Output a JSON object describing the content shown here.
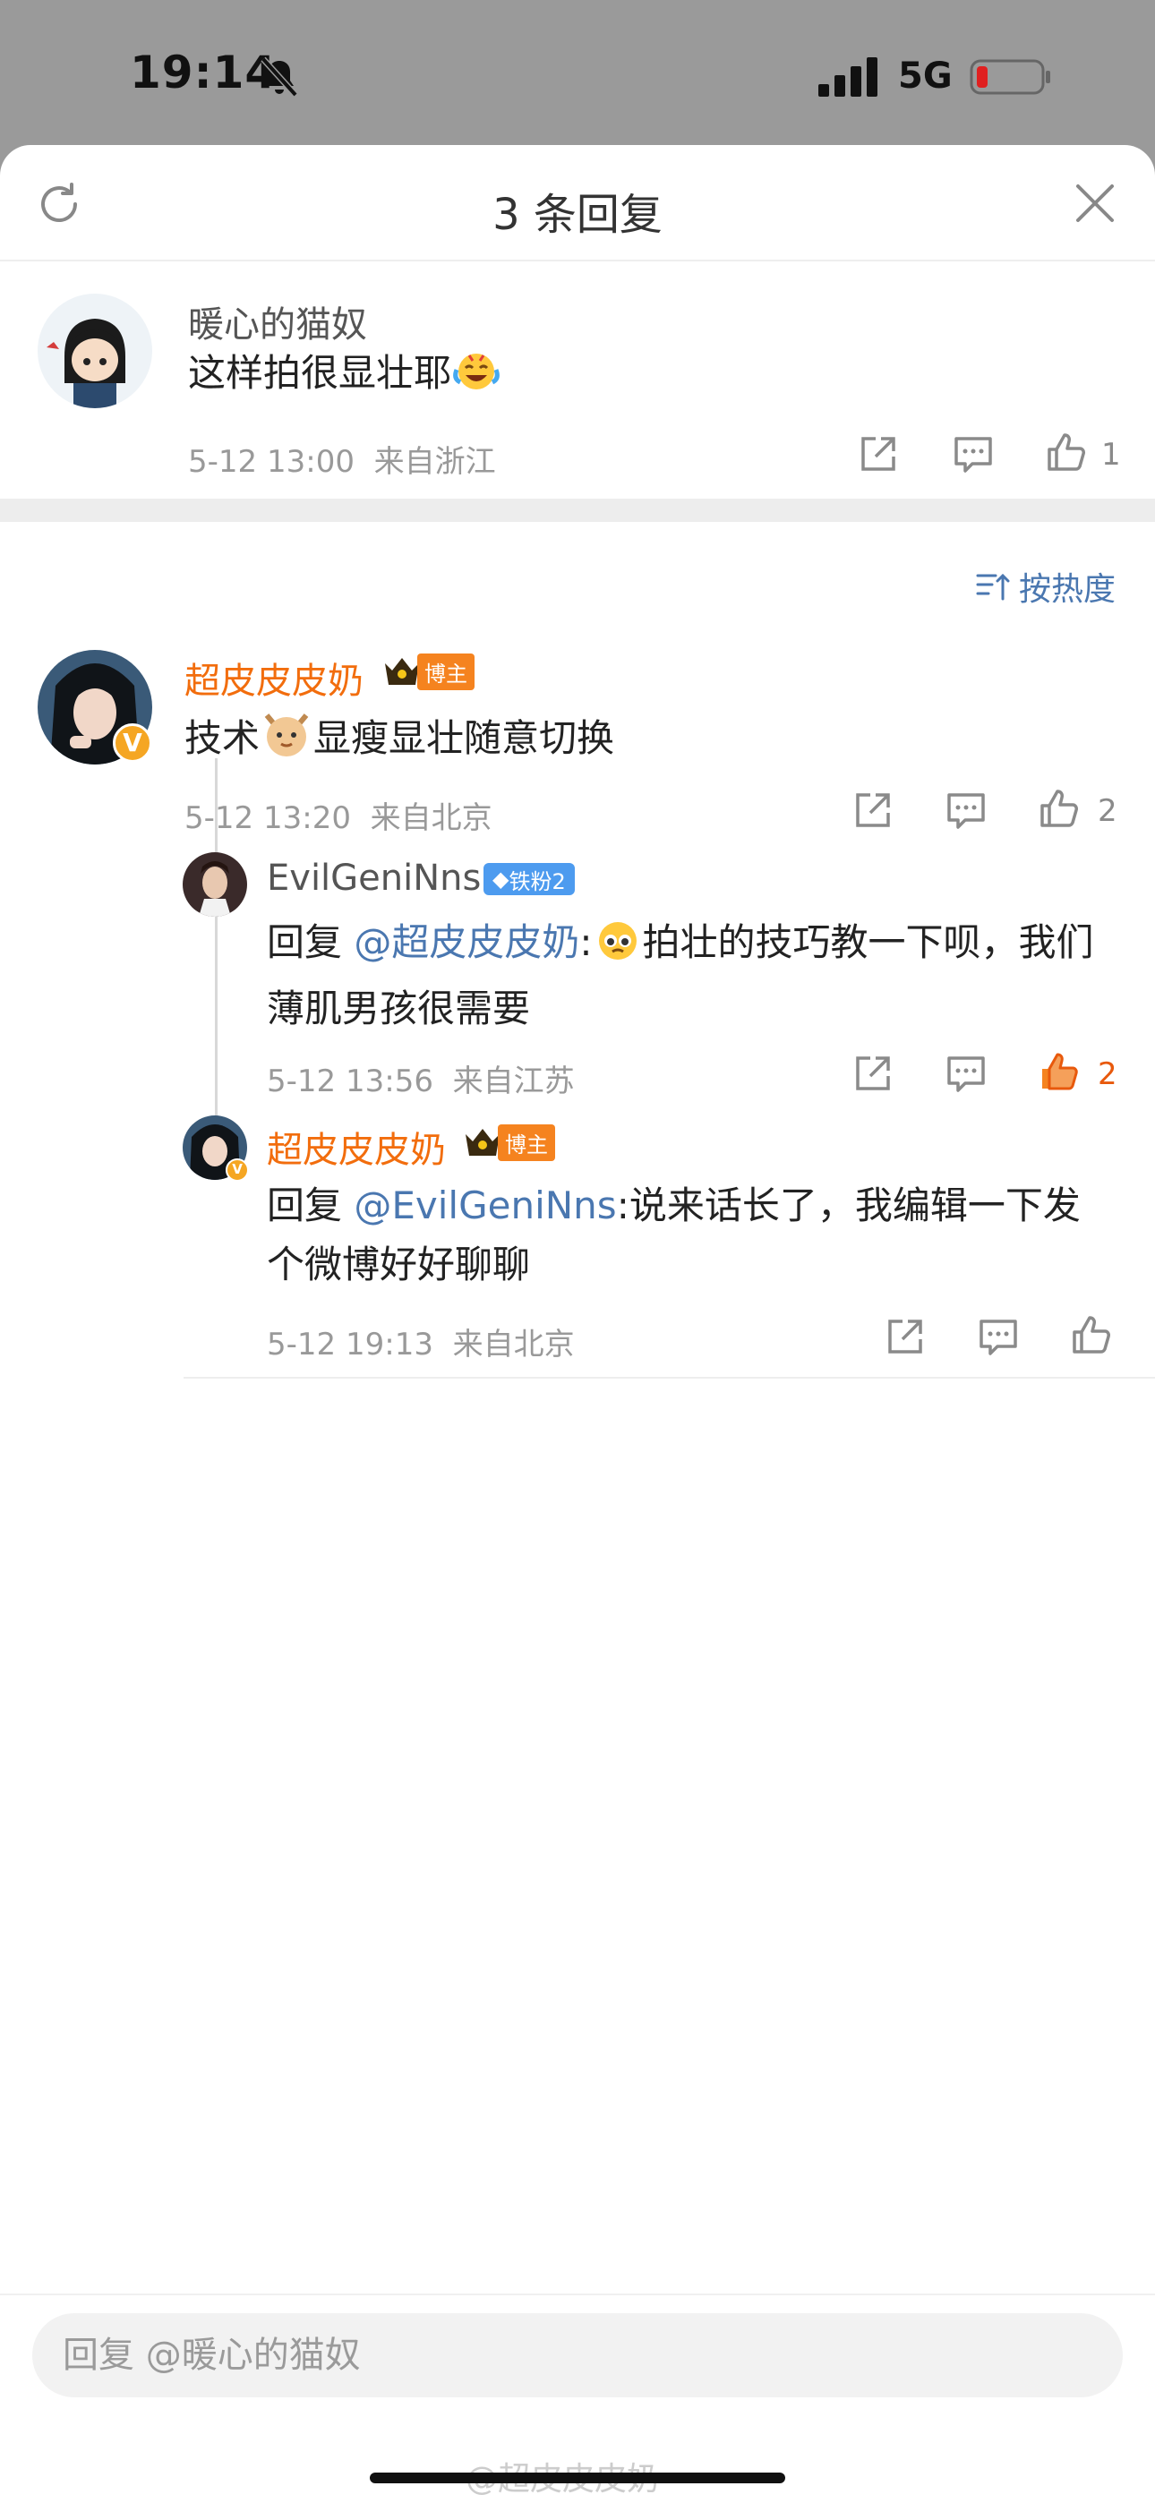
{
  "status_bar": {
    "time": "19:14",
    "network": "5G"
  },
  "header": {
    "title": "3 条回复"
  },
  "root_comment": {
    "username": "暖心的猫奴",
    "text": "这样拍很显壮耶",
    "date": "5-12 13:00",
    "location": "来自浙江",
    "like_count": "1"
  },
  "sort": {
    "label": "按热度"
  },
  "replies": [
    {
      "username": "超皮皮皮奶",
      "badge": "博主",
      "text_before": "技术",
      "text_after": "显瘦显壮随意切换",
      "date": "5-12 13:20",
      "location": "来自北京",
      "like_count": "2"
    },
    {
      "username": "EvilGeniNns",
      "fan_badge": "铁粉2",
      "reply_prefix": "回复 ",
      "mention": "@超皮皮皮奶",
      "colon": ":",
      "text": "拍壮的技巧教一下呗，我们薄肌男孩很需要",
      "date": "5-12 13:56",
      "location": "来自江苏",
      "like_count": "2",
      "liked": true
    },
    {
      "username": "超皮皮皮奶",
      "badge": "博主",
      "reply_prefix": "回复 ",
      "mention": "@EvilGeniNns",
      "text": ":说来话长了，我编辑一下发个微博好好聊聊",
      "date": "5-12 19:13",
      "location": "来自北京"
    }
  ],
  "input": {
    "placeholder": "回复 @暖心的猫奴"
  },
  "watermark": "@超皮皮皮奶",
  "colors": {
    "accent_blue": "#4a77b0",
    "name_orange": "#f26d0d",
    "liked_orange": "#e8590c",
    "badge_orange": "#f5831f",
    "fan_blue": "#4d9bef"
  }
}
